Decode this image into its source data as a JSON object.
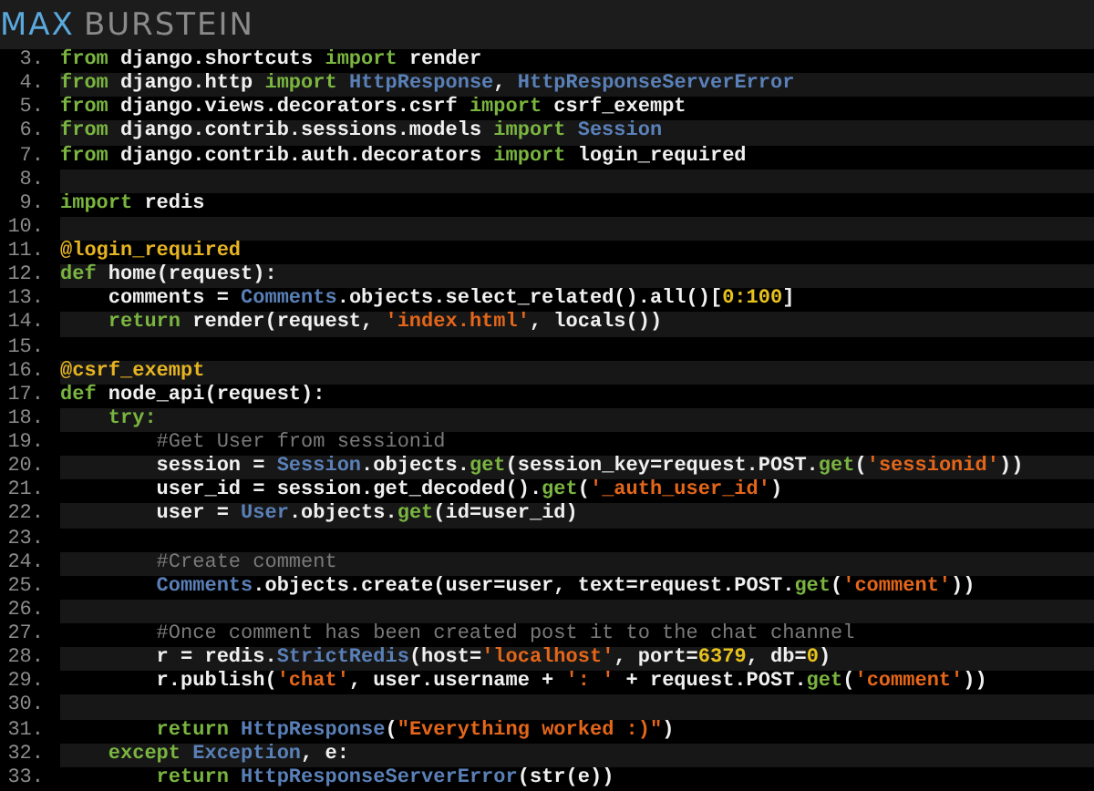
{
  "header": {
    "logo_first": "MAX",
    "logo_second": "BURSTEIN"
  },
  "code_lines": [
    {
      "number": "3.",
      "tokens": [
        {
          "kind": "kw",
          "text": "from"
        },
        {
          "kind": "plain",
          "text": " django.shortcuts "
        },
        {
          "kind": "kw",
          "text": "import"
        },
        {
          "kind": "plain",
          "text": " render"
        }
      ]
    },
    {
      "number": "4.",
      "tokens": [
        {
          "kind": "kw",
          "text": "from"
        },
        {
          "kind": "plain",
          "text": " django.http "
        },
        {
          "kind": "kw",
          "text": "import"
        },
        {
          "kind": "cls",
          "text": " HttpResponse"
        },
        {
          "kind": "plain",
          "text": ", "
        },
        {
          "kind": "cls",
          "text": "HttpResponseServerError"
        }
      ]
    },
    {
      "number": "5.",
      "tokens": [
        {
          "kind": "kw",
          "text": "from"
        },
        {
          "kind": "plain",
          "text": " django.views.decorators.csrf "
        },
        {
          "kind": "kw",
          "text": "import"
        },
        {
          "kind": "plain",
          "text": " csrf_exempt"
        }
      ]
    },
    {
      "number": "6.",
      "tokens": [
        {
          "kind": "kw",
          "text": "from"
        },
        {
          "kind": "plain",
          "text": " django.contrib.sessions.models "
        },
        {
          "kind": "kw",
          "text": "import"
        },
        {
          "kind": "cls",
          "text": " Session"
        }
      ]
    },
    {
      "number": "7.",
      "tokens": [
        {
          "kind": "kw",
          "text": "from"
        },
        {
          "kind": "plain",
          "text": " django.contrib.auth.decorators "
        },
        {
          "kind": "kw",
          "text": "import"
        },
        {
          "kind": "plain",
          "text": " login_required"
        }
      ]
    },
    {
      "number": "8."
    },
    {
      "number": "9.",
      "tokens": [
        {
          "kind": "kw",
          "text": "import"
        },
        {
          "kind": "plain",
          "text": " redis"
        }
      ]
    },
    {
      "number": "10."
    },
    {
      "number": "11.",
      "tokens": [
        {
          "kind": "dec",
          "text": "@login_required"
        }
      ]
    },
    {
      "number": "12.",
      "tokens": [
        {
          "kind": "kw",
          "text": "def"
        },
        {
          "kind": "plain",
          "text": " home(request):"
        }
      ]
    },
    {
      "number": "13.",
      "tokens": [
        {
          "kind": "plain",
          "text": "    comments = "
        },
        {
          "kind": "cls",
          "text": "Comments"
        },
        {
          "kind": "plain",
          "text": ".objects.select_related().all()["
        },
        {
          "kind": "num",
          "text": "0:100"
        },
        {
          "kind": "plain",
          "text": "]"
        }
      ]
    },
    {
      "number": "14.",
      "tokens": [
        {
          "kind": "kw",
          "text": "    return"
        },
        {
          "kind": "plain",
          "text": " render(request, "
        },
        {
          "kind": "str",
          "text": "'index.html'"
        },
        {
          "kind": "plain",
          "text": ", locals())"
        }
      ]
    },
    {
      "number": "15."
    },
    {
      "number": "16.",
      "tokens": [
        {
          "kind": "dec",
          "text": "@csrf_exempt"
        }
      ]
    },
    {
      "number": "17.",
      "tokens": [
        {
          "kind": "kw",
          "text": "def"
        },
        {
          "kind": "plain",
          "text": " node_api(request):"
        }
      ]
    },
    {
      "number": "18.",
      "tokens": [
        {
          "kind": "kw",
          "text": "    try:"
        }
      ]
    },
    {
      "number": "19.",
      "tokens": [
        {
          "kind": "com",
          "text": "        #Get User from sessionid"
        }
      ]
    },
    {
      "number": "20.",
      "tokens": [
        {
          "kind": "plain",
          "text": "        session = "
        },
        {
          "kind": "cls",
          "text": "Session"
        },
        {
          "kind": "plain",
          "text": ".objects."
        },
        {
          "kind": "kw",
          "text": "get"
        },
        {
          "kind": "plain",
          "text": "(session_key=request.POST."
        },
        {
          "kind": "kw",
          "text": "get"
        },
        {
          "kind": "plain",
          "text": "("
        },
        {
          "kind": "str",
          "text": "'sessionid'"
        },
        {
          "kind": "plain",
          "text": "))"
        }
      ]
    },
    {
      "number": "21.",
      "tokens": [
        {
          "kind": "plain",
          "text": "        user_id = session.get_decoded()."
        },
        {
          "kind": "kw",
          "text": "get"
        },
        {
          "kind": "plain",
          "text": "("
        },
        {
          "kind": "str",
          "text": "'_auth_user_id'"
        },
        {
          "kind": "plain",
          "text": ")"
        }
      ]
    },
    {
      "number": "22.",
      "tokens": [
        {
          "kind": "plain",
          "text": "        user = "
        },
        {
          "kind": "cls",
          "text": "User"
        },
        {
          "kind": "plain",
          "text": ".objects."
        },
        {
          "kind": "kw",
          "text": "get"
        },
        {
          "kind": "plain",
          "text": "(id=user_id)"
        }
      ]
    },
    {
      "number": "23."
    },
    {
      "number": "24.",
      "tokens": [
        {
          "kind": "com",
          "text": "        #Create comment"
        }
      ]
    },
    {
      "number": "25.",
      "tokens": [
        {
          "kind": "cls",
          "text": "        Comments"
        },
        {
          "kind": "plain",
          "text": ".objects.create(user=user, text=request.POST."
        },
        {
          "kind": "kw",
          "text": "get"
        },
        {
          "kind": "plain",
          "text": "("
        },
        {
          "kind": "str",
          "text": "'comment'"
        },
        {
          "kind": "plain",
          "text": "))"
        }
      ]
    },
    {
      "number": "26."
    },
    {
      "number": "27.",
      "tokens": [
        {
          "kind": "com",
          "text": "        #Once comment has been created post it to the chat channel"
        }
      ]
    },
    {
      "number": "28.",
      "tokens": [
        {
          "kind": "plain",
          "text": "        r = redis."
        },
        {
          "kind": "cls",
          "text": "StrictRedis"
        },
        {
          "kind": "plain",
          "text": "(host="
        },
        {
          "kind": "str",
          "text": "'localhost'"
        },
        {
          "kind": "plain",
          "text": ", port="
        },
        {
          "kind": "num",
          "text": "6379"
        },
        {
          "kind": "plain",
          "text": ", db="
        },
        {
          "kind": "num",
          "text": "0"
        },
        {
          "kind": "plain",
          "text": ")"
        }
      ]
    },
    {
      "number": "29.",
      "tokens": [
        {
          "kind": "plain",
          "text": "        r.publish("
        },
        {
          "kind": "str",
          "text": "'chat'"
        },
        {
          "kind": "plain",
          "text": ", user.username + "
        },
        {
          "kind": "str",
          "text": "': '"
        },
        {
          "kind": "plain",
          "text": " + request.POST."
        },
        {
          "kind": "kw",
          "text": "get"
        },
        {
          "kind": "plain",
          "text": "("
        },
        {
          "kind": "str",
          "text": "'comment'"
        },
        {
          "kind": "plain",
          "text": "))"
        }
      ]
    },
    {
      "number": "30."
    },
    {
      "number": "31.",
      "tokens": [
        {
          "kind": "kw",
          "text": "        return"
        },
        {
          "kind": "cls",
          "text": " HttpResponse"
        },
        {
          "kind": "plain",
          "text": "("
        },
        {
          "kind": "str",
          "text": "\"Everything worked :)\""
        },
        {
          "kind": "plain",
          "text": ")"
        }
      ]
    },
    {
      "number": "32.",
      "tokens": [
        {
          "kind": "kw",
          "text": "    except"
        },
        {
          "kind": "cls",
          "text": " Exception"
        },
        {
          "kind": "plain",
          "text": ", e:"
        }
      ]
    },
    {
      "number": "33.",
      "tokens": [
        {
          "kind": "kw",
          "text": "        return"
        },
        {
          "kind": "cls",
          "text": " HttpResponseServerError"
        },
        {
          "kind": "plain",
          "text": "(str(e))"
        }
      ]
    }
  ]
}
